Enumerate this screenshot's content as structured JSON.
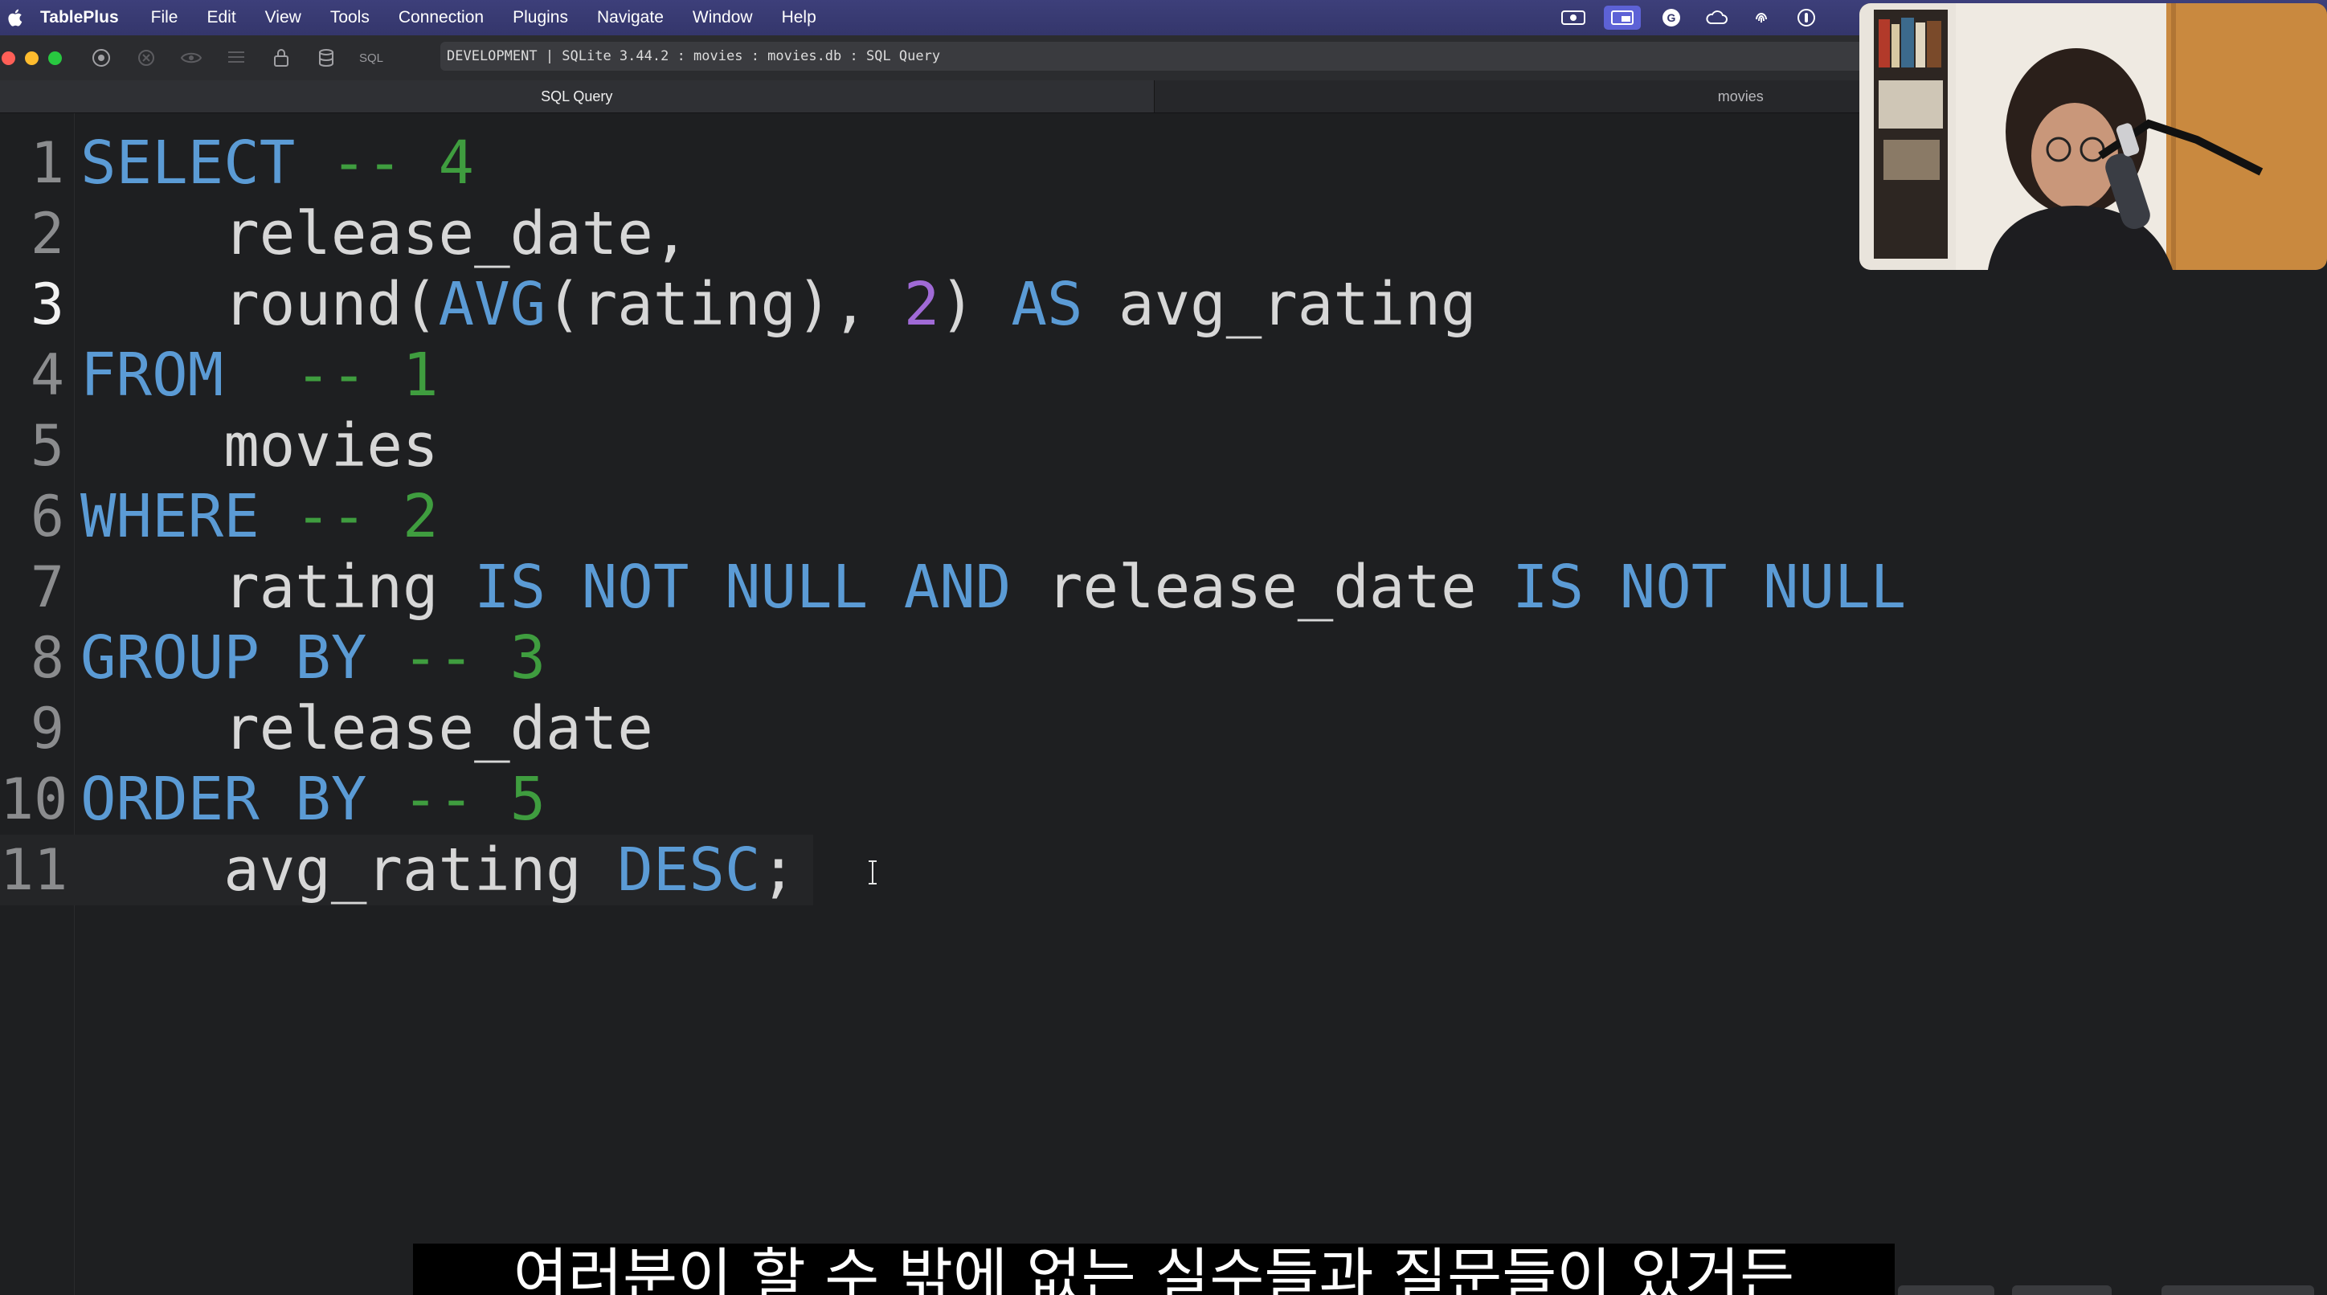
{
  "menubar": {
    "app_name": "TablePlus",
    "items": [
      "File",
      "Edit",
      "View",
      "Tools",
      "Connection",
      "Plugins",
      "Navigate",
      "Window",
      "Help"
    ]
  },
  "toolbar": {
    "sql_label": "SQL",
    "connection": "DEVELOPMENT | SQLite 3.44.2 : movies : movies.db : SQL Query"
  },
  "tabs": [
    {
      "label": "SQL Query",
      "active": true
    },
    {
      "label": "movies",
      "active": false
    }
  ],
  "editor": {
    "lines": [
      {
        "n": "1",
        "segments": [
          {
            "t": "SELECT",
            "c": "kw"
          },
          {
            "t": " ",
            "c": ""
          },
          {
            "t": "-- 4",
            "c": "cm"
          }
        ]
      },
      {
        "n": "2",
        "segments": [
          {
            "t": "    release_date,",
            "c": ""
          }
        ]
      },
      {
        "n": "3",
        "segments": [
          {
            "t": "    round(",
            "c": ""
          },
          {
            "t": "AVG",
            "c": "kw"
          },
          {
            "t": "(rating), ",
            "c": ""
          },
          {
            "t": "2",
            "c": "nm"
          },
          {
            "t": ") ",
            "c": ""
          },
          {
            "t": "AS",
            "c": "kw"
          },
          {
            "t": " avg_rating",
            "c": ""
          }
        ]
      },
      {
        "n": "4",
        "segments": [
          {
            "t": "FROM",
            "c": "kw"
          },
          {
            "t": "  ",
            "c": ""
          },
          {
            "t": "-- 1",
            "c": "cm"
          }
        ]
      },
      {
        "n": "5",
        "segments": [
          {
            "t": "    movies",
            "c": ""
          }
        ]
      },
      {
        "n": "6",
        "segments": [
          {
            "t": "WHERE",
            "c": "kw"
          },
          {
            "t": " ",
            "c": ""
          },
          {
            "t": "-- 2",
            "c": "cm"
          }
        ]
      },
      {
        "n": "7",
        "segments": [
          {
            "t": "    rating ",
            "c": ""
          },
          {
            "t": "IS NOT NULL AND",
            "c": "kw"
          },
          {
            "t": " release_date ",
            "c": ""
          },
          {
            "t": "IS NOT NULL",
            "c": "kw"
          }
        ]
      },
      {
        "n": "8",
        "segments": [
          {
            "t": "GROUP BY",
            "c": "kw"
          },
          {
            "t": " ",
            "c": ""
          },
          {
            "t": "-- 3",
            "c": "cm"
          }
        ]
      },
      {
        "n": "9",
        "segments": [
          {
            "t": "    release_date",
            "c": ""
          }
        ]
      },
      {
        "n": "10",
        "segments": [
          {
            "t": "ORDER BY",
            "c": "kw"
          },
          {
            "t": " ",
            "c": ""
          },
          {
            "t": "-- 5",
            "c": "cm"
          }
        ]
      },
      {
        "n": "11",
        "segments": [
          {
            "t": "    avg_rating ",
            "c": ""
          },
          {
            "t": "DESC",
            "c": "kw"
          },
          {
            "t": ";",
            "c": ""
          }
        ]
      }
    ],
    "current_line": "3"
  },
  "subtitle": "여러분이 할 수 밖에 없는 실수들과 질문들이 있거든",
  "colors": {
    "keyword": "#5b9bd5",
    "comment": "#3f9d3f",
    "number": "#a06ad6",
    "menubar": "#3d3f7a"
  }
}
